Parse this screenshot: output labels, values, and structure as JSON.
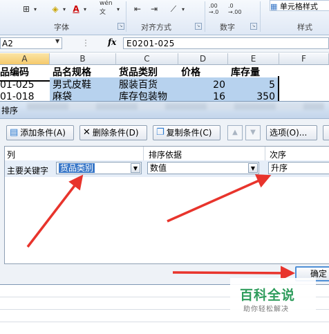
{
  "ribbon": {
    "groups": [
      {
        "label": "字体"
      },
      {
        "label": "对齐方式"
      },
      {
        "label": "数字"
      },
      {
        "label": "样式"
      }
    ],
    "cell_style_label": "单元格样式",
    "wen_icon_label": "wén 文",
    "number_format_inc": ".00 →.0",
    "number_format_dec": ".0 →.00"
  },
  "formula_bar": {
    "name_box": "A2",
    "fx_label": "fx",
    "formula": "E0201-025"
  },
  "sheet": {
    "columns": [
      "A",
      "B",
      "C",
      "D",
      "E",
      "F"
    ],
    "header_row": [
      "品编码",
      "品名规格",
      "货品类别",
      "价格",
      "库存量"
    ],
    "rows": [
      [
        "01-025",
        "男式皮鞋",
        "服装百货",
        "20",
        "5"
      ],
      [
        "01-018",
        "麻袋",
        "库存包装物",
        "16",
        "350"
      ]
    ]
  },
  "dialog": {
    "title": "排序",
    "buttons": {
      "add": "添加条件(A)",
      "delete": "删除条件(D)",
      "copy": "复制条件(C)",
      "options": "选项(O)..."
    },
    "grid": {
      "col_headers": [
        "列",
        "排序依据",
        "次序"
      ],
      "row_label": "主要关键字",
      "column_value": "货品类别",
      "sort_on_value": "数值",
      "order_value": "升序"
    },
    "ok_label": "确定"
  },
  "watermark": {
    "title": "百科全说",
    "subtitle": "助你轻松解决"
  },
  "colors": {
    "selection": "#b7d2ee",
    "arrow_red": "#e8342c",
    "dialog_bg": "#eef2f7",
    "combo_selected": "#3a78c8",
    "watermark_green": "#2e9c5c"
  }
}
